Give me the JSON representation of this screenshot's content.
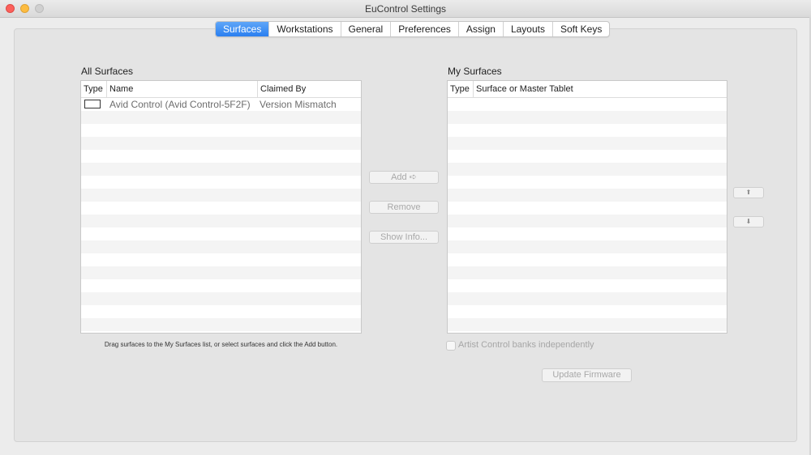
{
  "window": {
    "title": "EuControl Settings"
  },
  "tabs": [
    {
      "label": "Surfaces",
      "active": true
    },
    {
      "label": "Workstations",
      "active": false
    },
    {
      "label": "General",
      "active": false
    },
    {
      "label": "Preferences",
      "active": false
    },
    {
      "label": "Assign",
      "active": false
    },
    {
      "label": "Layouts",
      "active": false
    },
    {
      "label": "Soft Keys",
      "active": false
    }
  ],
  "all_surfaces": {
    "title": "All Surfaces",
    "columns": [
      "Type",
      "Name",
      "Claimed By"
    ],
    "rows": [
      {
        "type_icon": "device-icon",
        "name": "Avid Control (Avid Control-5F2F)",
        "claimed_by": "Version Mismatch"
      }
    ],
    "hint": "Drag surfaces to the My Surfaces list, or select surfaces and click the Add button."
  },
  "actions": {
    "add": "Add ➪",
    "remove": "Remove",
    "show_info": "Show Info..."
  },
  "my_surfaces": {
    "title": "My Surfaces",
    "columns": [
      "Type",
      "Surface or Master Tablet"
    ],
    "move_up": "⬆",
    "move_down": "⬇"
  },
  "options": {
    "artist_control_banks": {
      "label": "Artist Control banks independently",
      "checked": false
    },
    "update_firmware": "Update Firmware"
  },
  "colors": {
    "accent": "#2a7ff0",
    "disabled_text": "#a8a8a8"
  }
}
